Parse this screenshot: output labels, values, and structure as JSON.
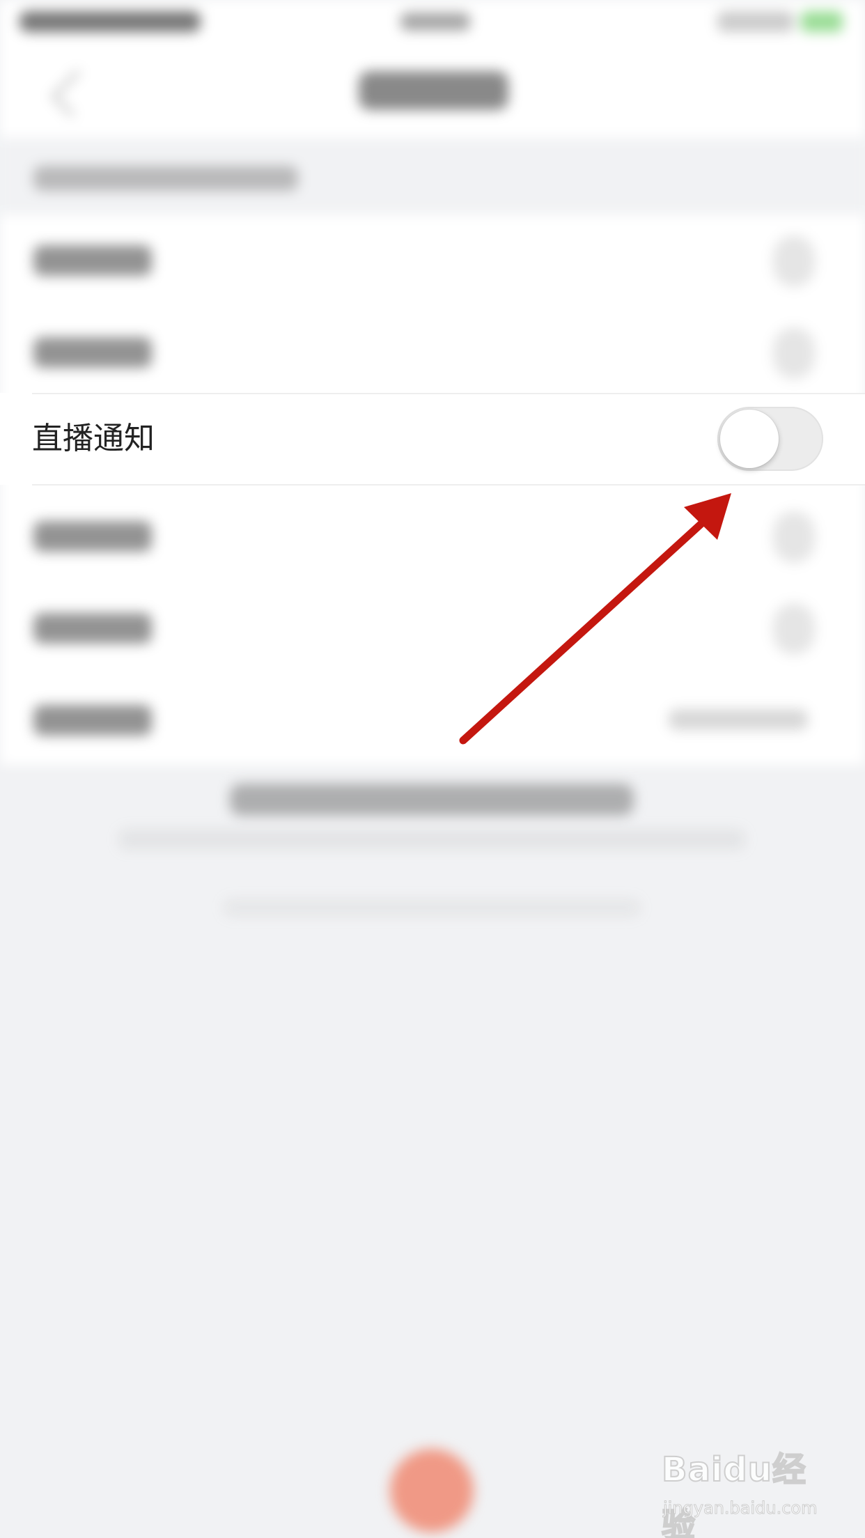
{
  "settings": {
    "focused_item": {
      "label": "直播通知",
      "toggle_on": false
    }
  },
  "annotation": {
    "arrow_color": "#c4170f"
  },
  "watermark": {
    "logo_text": "Baidu经验",
    "url": "jingyan.baidu.com"
  },
  "colors": {
    "background": "#f1f2f4",
    "toggle_off_track": "#ececec",
    "bottom_button": "#f08a72"
  }
}
